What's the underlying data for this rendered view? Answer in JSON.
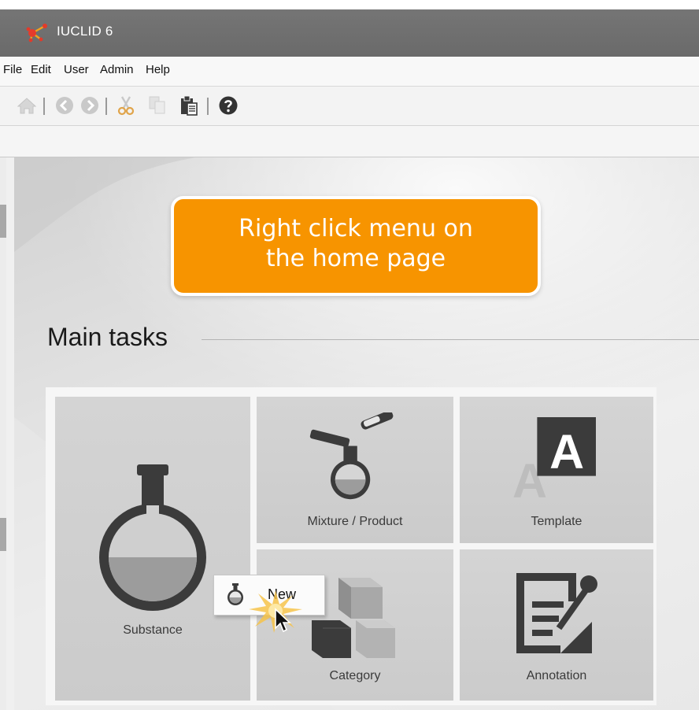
{
  "app": {
    "title": "IUCLID 6",
    "logo_icon": "iuclid-molecule-logo"
  },
  "menu": {
    "items": [
      "File",
      "Edit",
      "User",
      "Admin",
      "Help"
    ]
  },
  "toolbar": {
    "icons": [
      "home-icon",
      "back-icon",
      "forward-icon",
      "cut-icon",
      "copy-icon",
      "paste-icon",
      "help-icon"
    ]
  },
  "callout": {
    "line1": "Right click menu on",
    "line2": "the home page",
    "color": "#f79400"
  },
  "main": {
    "section_title": "Main tasks",
    "tiles": {
      "substance": "Substance",
      "mixture": "Mixture / Product",
      "template": "Template",
      "category": "Category",
      "annotation": "Annotation"
    }
  },
  "context_menu": {
    "new_label": "New",
    "icon": "flask-icon"
  }
}
